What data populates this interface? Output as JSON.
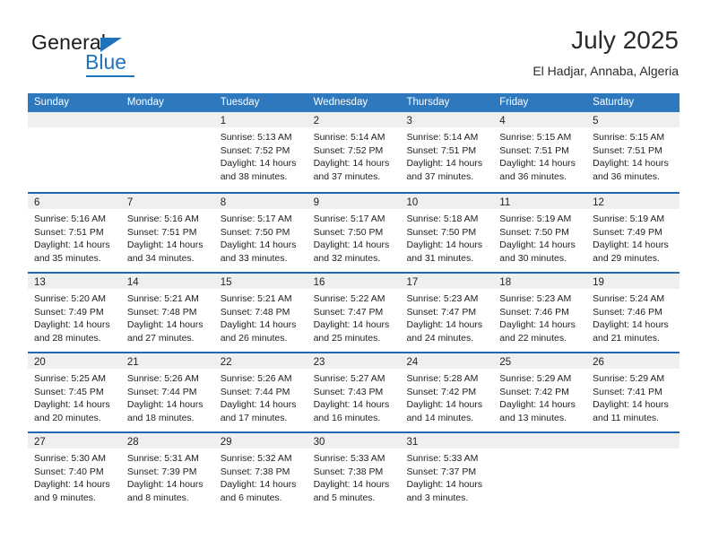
{
  "brand": {
    "name_part1": "General",
    "name_part2": "Blue"
  },
  "header": {
    "title": "July 2025",
    "subtitle": "El Hadjar, Annaba, Algeria"
  },
  "colors": {
    "header_blue": "#2e78bd",
    "row_rule_blue": "#1f69b3",
    "daynum_band": "#efefef",
    "brand_blue": "#1f73bb"
  },
  "weekdays": [
    "Sunday",
    "Monday",
    "Tuesday",
    "Wednesday",
    "Thursday",
    "Friday",
    "Saturday"
  ],
  "weeks": [
    [
      {
        "day": "",
        "lines": []
      },
      {
        "day": "",
        "lines": []
      },
      {
        "day": "1",
        "lines": [
          "Sunrise: 5:13 AM",
          "Sunset: 7:52 PM",
          "Daylight: 14 hours",
          "and 38 minutes."
        ]
      },
      {
        "day": "2",
        "lines": [
          "Sunrise: 5:14 AM",
          "Sunset: 7:52 PM",
          "Daylight: 14 hours",
          "and 37 minutes."
        ]
      },
      {
        "day": "3",
        "lines": [
          "Sunrise: 5:14 AM",
          "Sunset: 7:51 PM",
          "Daylight: 14 hours",
          "and 37 minutes."
        ]
      },
      {
        "day": "4",
        "lines": [
          "Sunrise: 5:15 AM",
          "Sunset: 7:51 PM",
          "Daylight: 14 hours",
          "and 36 minutes."
        ]
      },
      {
        "day": "5",
        "lines": [
          "Sunrise: 5:15 AM",
          "Sunset: 7:51 PM",
          "Daylight: 14 hours",
          "and 36 minutes."
        ]
      }
    ],
    [
      {
        "day": "6",
        "lines": [
          "Sunrise: 5:16 AM",
          "Sunset: 7:51 PM",
          "Daylight: 14 hours",
          "and 35 minutes."
        ]
      },
      {
        "day": "7",
        "lines": [
          "Sunrise: 5:16 AM",
          "Sunset: 7:51 PM",
          "Daylight: 14 hours",
          "and 34 minutes."
        ]
      },
      {
        "day": "8",
        "lines": [
          "Sunrise: 5:17 AM",
          "Sunset: 7:50 PM",
          "Daylight: 14 hours",
          "and 33 minutes."
        ]
      },
      {
        "day": "9",
        "lines": [
          "Sunrise: 5:17 AM",
          "Sunset: 7:50 PM",
          "Daylight: 14 hours",
          "and 32 minutes."
        ]
      },
      {
        "day": "10",
        "lines": [
          "Sunrise: 5:18 AM",
          "Sunset: 7:50 PM",
          "Daylight: 14 hours",
          "and 31 minutes."
        ]
      },
      {
        "day": "11",
        "lines": [
          "Sunrise: 5:19 AM",
          "Sunset: 7:50 PM",
          "Daylight: 14 hours",
          "and 30 minutes."
        ]
      },
      {
        "day": "12",
        "lines": [
          "Sunrise: 5:19 AM",
          "Sunset: 7:49 PM",
          "Daylight: 14 hours",
          "and 29 minutes."
        ]
      }
    ],
    [
      {
        "day": "13",
        "lines": [
          "Sunrise: 5:20 AM",
          "Sunset: 7:49 PM",
          "Daylight: 14 hours",
          "and 28 minutes."
        ]
      },
      {
        "day": "14",
        "lines": [
          "Sunrise: 5:21 AM",
          "Sunset: 7:48 PM",
          "Daylight: 14 hours",
          "and 27 minutes."
        ]
      },
      {
        "day": "15",
        "lines": [
          "Sunrise: 5:21 AM",
          "Sunset: 7:48 PM",
          "Daylight: 14 hours",
          "and 26 minutes."
        ]
      },
      {
        "day": "16",
        "lines": [
          "Sunrise: 5:22 AM",
          "Sunset: 7:47 PM",
          "Daylight: 14 hours",
          "and 25 minutes."
        ]
      },
      {
        "day": "17",
        "lines": [
          "Sunrise: 5:23 AM",
          "Sunset: 7:47 PM",
          "Daylight: 14 hours",
          "and 24 minutes."
        ]
      },
      {
        "day": "18",
        "lines": [
          "Sunrise: 5:23 AM",
          "Sunset: 7:46 PM",
          "Daylight: 14 hours",
          "and 22 minutes."
        ]
      },
      {
        "day": "19",
        "lines": [
          "Sunrise: 5:24 AM",
          "Sunset: 7:46 PM",
          "Daylight: 14 hours",
          "and 21 minutes."
        ]
      }
    ],
    [
      {
        "day": "20",
        "lines": [
          "Sunrise: 5:25 AM",
          "Sunset: 7:45 PM",
          "Daylight: 14 hours",
          "and 20 minutes."
        ]
      },
      {
        "day": "21",
        "lines": [
          "Sunrise: 5:26 AM",
          "Sunset: 7:44 PM",
          "Daylight: 14 hours",
          "and 18 minutes."
        ]
      },
      {
        "day": "22",
        "lines": [
          "Sunrise: 5:26 AM",
          "Sunset: 7:44 PM",
          "Daylight: 14 hours",
          "and 17 minutes."
        ]
      },
      {
        "day": "23",
        "lines": [
          "Sunrise: 5:27 AM",
          "Sunset: 7:43 PM",
          "Daylight: 14 hours",
          "and 16 minutes."
        ]
      },
      {
        "day": "24",
        "lines": [
          "Sunrise: 5:28 AM",
          "Sunset: 7:42 PM",
          "Daylight: 14 hours",
          "and 14 minutes."
        ]
      },
      {
        "day": "25",
        "lines": [
          "Sunrise: 5:29 AM",
          "Sunset: 7:42 PM",
          "Daylight: 14 hours",
          "and 13 minutes."
        ]
      },
      {
        "day": "26",
        "lines": [
          "Sunrise: 5:29 AM",
          "Sunset: 7:41 PM",
          "Daylight: 14 hours",
          "and 11 minutes."
        ]
      }
    ],
    [
      {
        "day": "27",
        "lines": [
          "Sunrise: 5:30 AM",
          "Sunset: 7:40 PM",
          "Daylight: 14 hours",
          "and 9 minutes."
        ]
      },
      {
        "day": "28",
        "lines": [
          "Sunrise: 5:31 AM",
          "Sunset: 7:39 PM",
          "Daylight: 14 hours",
          "and 8 minutes."
        ]
      },
      {
        "day": "29",
        "lines": [
          "Sunrise: 5:32 AM",
          "Sunset: 7:38 PM",
          "Daylight: 14 hours",
          "and 6 minutes."
        ]
      },
      {
        "day": "30",
        "lines": [
          "Sunrise: 5:33 AM",
          "Sunset: 7:38 PM",
          "Daylight: 14 hours",
          "and 5 minutes."
        ]
      },
      {
        "day": "31",
        "lines": [
          "Sunrise: 5:33 AM",
          "Sunset: 7:37 PM",
          "Daylight: 14 hours",
          "and 3 minutes."
        ]
      },
      {
        "day": "",
        "lines": []
      },
      {
        "day": "",
        "lines": []
      }
    ]
  ]
}
